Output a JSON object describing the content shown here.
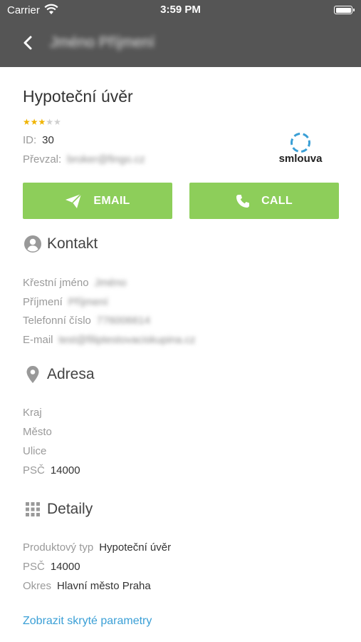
{
  "status_bar": {
    "carrier": "Carrier",
    "time": "3:59 PM",
    "battery_level": 1.0
  },
  "nav": {
    "back_icon": "chevron-left-icon",
    "title": "Jméno Příjmení"
  },
  "header": {
    "title": "Hypoteční úvěr",
    "rating": {
      "value": 3,
      "max": 5
    },
    "id_label": "ID:",
    "id_value": "30",
    "taken_label": "Převzal:",
    "taken_value": "broker@fingo.cz",
    "logo_text": "smlouva"
  },
  "actions": {
    "email_label": "EMAIL",
    "call_label": "CALL",
    "color": "#8dce5a"
  },
  "contact": {
    "title": "Kontakt",
    "icon": "person-icon",
    "fields": [
      {
        "label": "Křestní jméno",
        "value": "Jméno"
      },
      {
        "label": "Příjmení",
        "value": "Příjmení"
      },
      {
        "label": "Telefonní číslo",
        "value": "776006614"
      },
      {
        "label": "E-mail",
        "value": "test@filiptestovaciskupina.cz"
      }
    ]
  },
  "address": {
    "title": "Adresa",
    "icon": "location-pin-icon",
    "fields": [
      {
        "label": "Kraj",
        "value": ""
      },
      {
        "label": "Město",
        "value": ""
      },
      {
        "label": "Ulice",
        "value": ""
      },
      {
        "label": "PSČ",
        "value": "14000"
      }
    ]
  },
  "details": {
    "title": "Detaily",
    "icon": "grid-icon",
    "fields": [
      {
        "label": "Produktový typ",
        "value": "Hypoteční úvěr"
      },
      {
        "label": "PSČ",
        "value": "14000"
      },
      {
        "label": "Okres",
        "value": "Hlavní město Praha"
      }
    ]
  },
  "show_hidden_link": "Zobrazit skryté parametry",
  "colors": {
    "header_bg": "#555555",
    "link": "#3a9fd6",
    "star": "#f0b400"
  }
}
